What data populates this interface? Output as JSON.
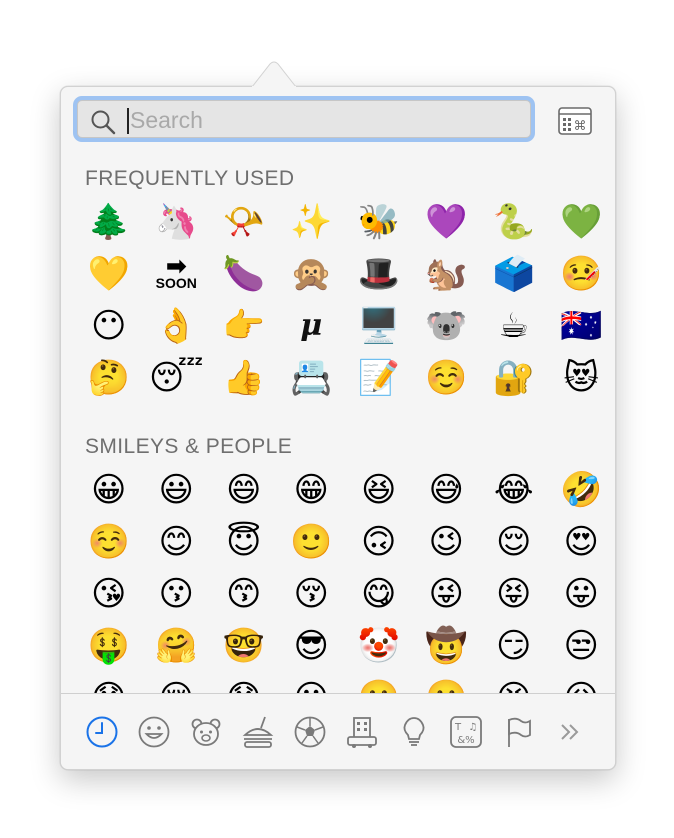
{
  "search": {
    "placeholder": "Search",
    "value": ""
  },
  "sections": [
    {
      "title": "FREQUENTLY USED",
      "emojis": [
        "🌲",
        "🦄",
        "📯",
        "✨",
        "🐝",
        "💜",
        "🐍",
        "💚",
        "💛",
        "🔜",
        "🍆",
        "🙊",
        "🎩",
        "🐿️",
        "🗳️",
        "🤒",
        "😶",
        "👌",
        "👉",
        "μ",
        "🖥️",
        "🐨",
        "☕",
        "🇦🇺",
        "🤔",
        "😴",
        "👍",
        "📇",
        "📝",
        "☺️",
        "🔐",
        "😻"
      ]
    },
    {
      "title": "SMILEYS & PEOPLE",
      "emojis": [
        "😀",
        "😃",
        "😄",
        "😁",
        "😆",
        "😅",
        "😂",
        "🤣",
        "☺️",
        "😊",
        "😇",
        "🙂",
        "🙃",
        "😉",
        "😌",
        "😍",
        "😘",
        "😗",
        "😙",
        "😚",
        "😋",
        "😜",
        "😝",
        "😛",
        "🤑",
        "🤗",
        "🤓",
        "😎",
        "🤡",
        "🤠",
        "😏",
        "😒",
        "😞",
        "😔",
        "😟",
        "😕",
        "🙁",
        "☹️",
        "😣",
        "😖"
      ]
    }
  ],
  "soon_label": "SOON",
  "categories": [
    {
      "name": "recent",
      "icon": "clock-icon",
      "active": true
    },
    {
      "name": "smileys",
      "icon": "smiley-icon",
      "active": false
    },
    {
      "name": "animals",
      "icon": "bear-icon",
      "active": false
    },
    {
      "name": "food",
      "icon": "burger-icon",
      "active": false
    },
    {
      "name": "activity",
      "icon": "soccer-ball-icon",
      "active": false
    },
    {
      "name": "travel",
      "icon": "building-icon",
      "active": false
    },
    {
      "name": "objects",
      "icon": "lightbulb-icon",
      "active": false
    },
    {
      "name": "symbols",
      "icon": "symbols-icon",
      "active": false
    },
    {
      "name": "flags",
      "icon": "flag-icon",
      "active": false
    },
    {
      "name": "more",
      "icon": "double-chevron-icon",
      "active": false
    }
  ],
  "colors": {
    "accent": "#1a73e8",
    "focus_ring": "#9ec3f2",
    "icon_gray": "#7a7a7a",
    "section_title": "#6f6f6f"
  }
}
